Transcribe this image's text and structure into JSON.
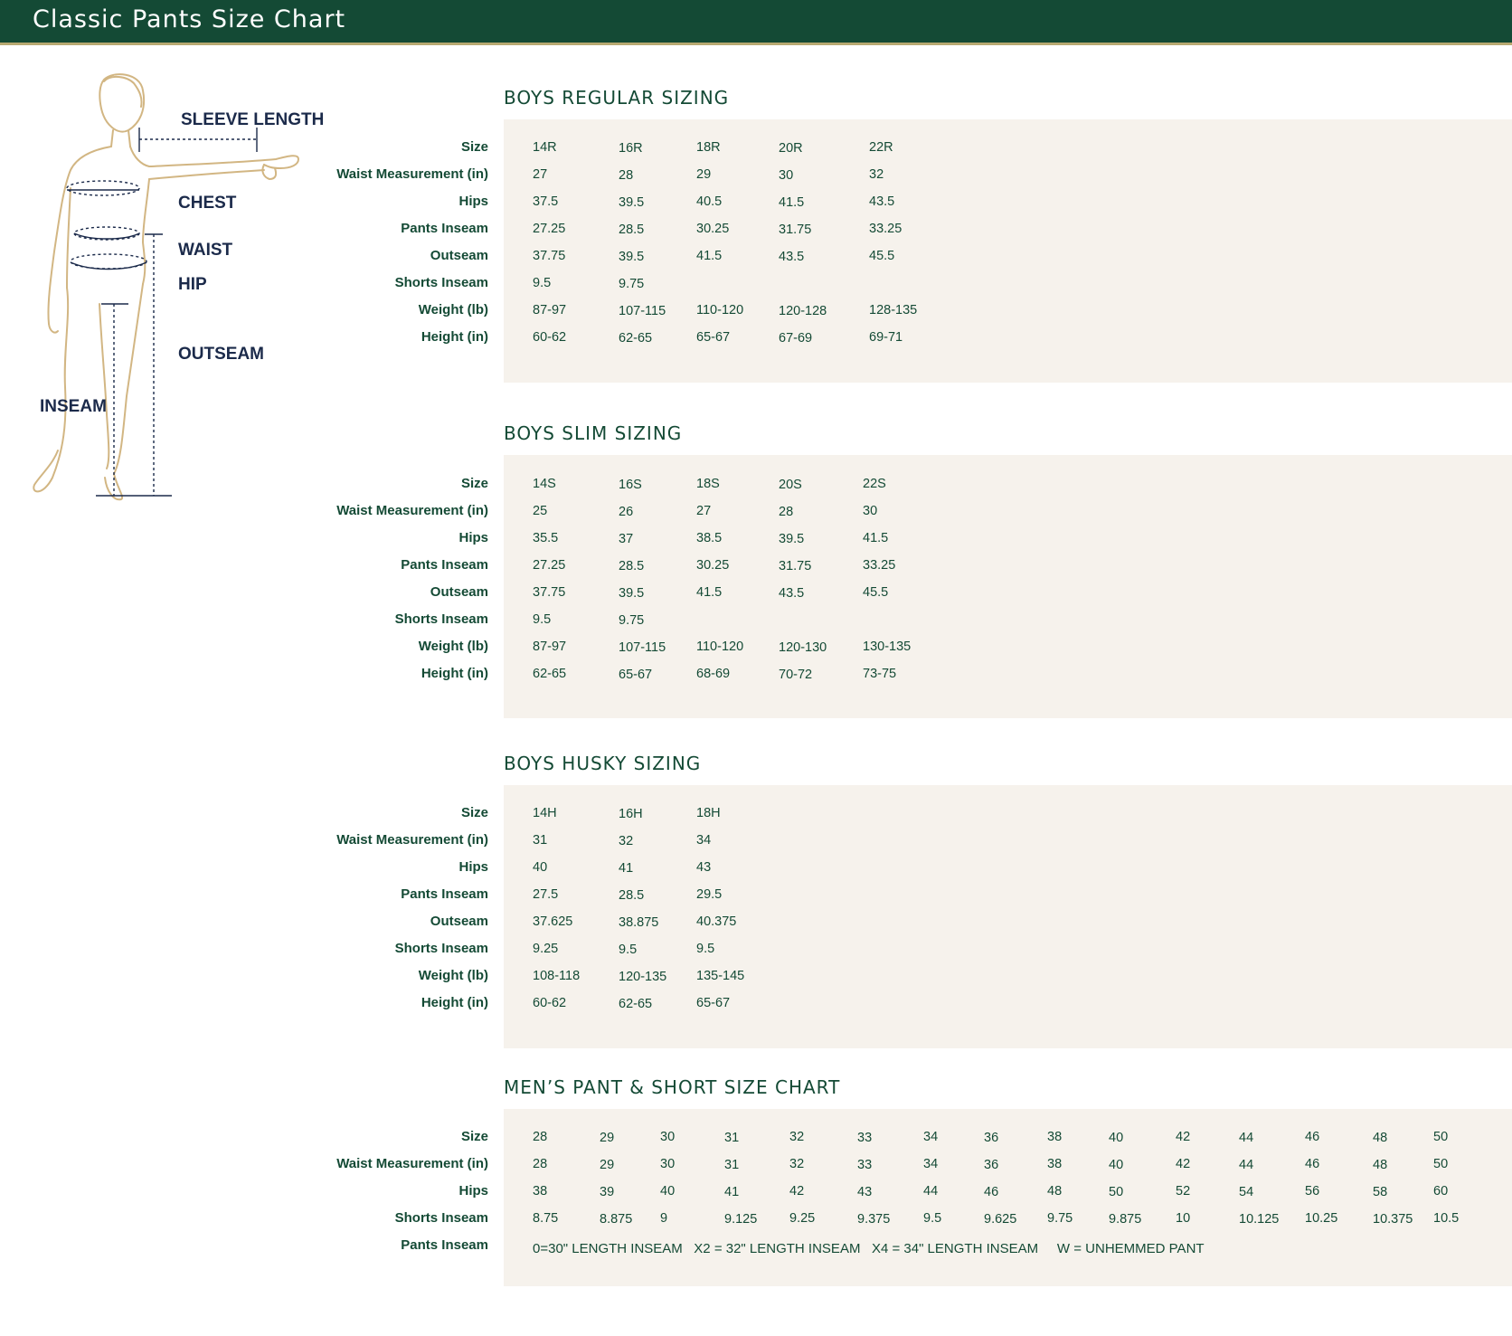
{
  "header": {
    "title": "Classic Pants Size Chart"
  },
  "figure": {
    "labels": {
      "sleeve_length": "SLEEVE LENGTH",
      "chest": "CHEST",
      "waist": "WAIST",
      "hip": "HIP",
      "outseam": "OUTSEAM",
      "inseam": "INSEAM"
    }
  },
  "sections": [
    {
      "title": "BOYS REGULAR SIZING",
      "rows": [
        {
          "label": "Size",
          "values": [
            "14R",
            "16R",
            "18R",
            "20R",
            "22R"
          ]
        },
        {
          "label": "Waist Measurement (in)",
          "values": [
            "27",
            "28",
            "29",
            "30",
            "32"
          ]
        },
        {
          "label": "Hips",
          "values": [
            "37.5",
            "39.5",
            "40.5",
            "41.5",
            "43.5"
          ]
        },
        {
          "label": "Pants Inseam",
          "values": [
            "27.25",
            "28.5",
            "30.25",
            "31.75",
            "33.25"
          ]
        },
        {
          "label": "Outseam",
          "values": [
            "37.75",
            "39.5",
            "41.5",
            "43.5",
            "45.5"
          ]
        },
        {
          "label": "Shorts Inseam",
          "values": [
            "9.5",
            "9.75"
          ]
        },
        {
          "label": "Weight (lb)",
          "values": [
            "87-97",
            "107-115",
            "110-120",
            "120-128",
            "128-135"
          ]
        },
        {
          "label": "Height (in)",
          "values": [
            "60-62",
            "62-65",
            "65-67",
            "67-69",
            "69-71"
          ]
        }
      ]
    },
    {
      "title": "BOYS SLIM SIZING",
      "rows": [
        {
          "label": "Size",
          "values": [
            "14S",
            "16S",
            "18S",
            "20S",
            "22S"
          ]
        },
        {
          "label": "Waist Measurement (in)",
          "values": [
            "25",
            "26",
            "27",
            "28",
            "30"
          ]
        },
        {
          "label": "Hips",
          "values": [
            "35.5",
            "37",
            "38.5",
            "39.5",
            "41.5"
          ]
        },
        {
          "label": "Pants Inseam",
          "values": [
            "27.25",
            "28.5",
            "30.25",
            "31.75",
            "33.25"
          ]
        },
        {
          "label": "Outseam",
          "values": [
            "37.75",
            "39.5",
            "41.5",
            "43.5",
            "45.5"
          ]
        },
        {
          "label": "Shorts Inseam",
          "values": [
            "9.5",
            "9.75"
          ]
        },
        {
          "label": "Weight (lb)",
          "values": [
            "87-97",
            "107-115",
            "110-120",
            "120-130",
            "130-135"
          ]
        },
        {
          "label": "Height (in)",
          "values": [
            "62-65",
            "65-67",
            "68-69",
            "70-72",
            "73-75"
          ]
        }
      ]
    },
    {
      "title": "BOYS HUSKY SIZING",
      "rows": [
        {
          "label": "Size",
          "values": [
            "14H",
            "16H",
            "18H"
          ]
        },
        {
          "label": "Waist Measurement (in)",
          "values": [
            "31",
            "32",
            "34"
          ]
        },
        {
          "label": "Hips",
          "values": [
            "40",
            "41",
            "43"
          ]
        },
        {
          "label": "Pants Inseam",
          "values": [
            "27.5",
            "28.5",
            "29.5"
          ]
        },
        {
          "label": "Outseam",
          "values": [
            "37.625",
            "38.875",
            "40.375"
          ]
        },
        {
          "label": "Shorts Inseam",
          "values": [
            "9.25",
            "9.5",
            "9.5"
          ]
        },
        {
          "label": "Weight (lb)",
          "values": [
            "108-118",
            "120-135",
            "135-145"
          ]
        },
        {
          "label": "Height (in)",
          "values": [
            "60-62",
            "62-65",
            "65-67"
          ]
        }
      ]
    },
    {
      "title": "MEN’S PANT & SHORT SIZE CHART",
      "rows": [
        {
          "label": "Size",
          "values": [
            "28",
            "29",
            "30",
            "31",
            "32",
            "33",
            "34",
            "36",
            "38",
            "40",
            "42",
            "44",
            "46",
            "48",
            "50"
          ]
        },
        {
          "label": "Waist Measurement (in)",
          "values": [
            "28",
            "29",
            "30",
            "31",
            "32",
            "33",
            "34",
            "36",
            "38",
            "40",
            "42",
            "44",
            "46",
            "48",
            "50"
          ]
        },
        {
          "label": "Hips",
          "values": [
            "38",
            "39",
            "40",
            "41",
            "42",
            "43",
            "44",
            "46",
            "48",
            "50",
            "52",
            "54",
            "56",
            "58",
            "60"
          ]
        },
        {
          "label": "Shorts Inseam",
          "values": [
            "8.75",
            "8.875",
            "9",
            "9.125",
            "9.25",
            "9.375",
            "9.5",
            "9.625",
            "9.75",
            "9.875",
            "10",
            "10.125",
            "10.25",
            "10.375",
            "10.5"
          ]
        },
        {
          "label": "Pants Inseam",
          "note": "0=30\" LENGTH INSEAM   X2 = 32\" LENGTH INSEAM   X4 = 34\" LENGTH INSEAM     W = UNHEMMED PANT"
        }
      ]
    }
  ]
}
